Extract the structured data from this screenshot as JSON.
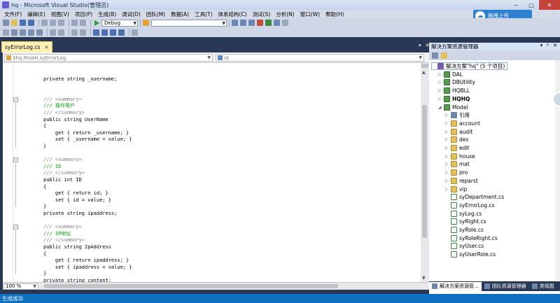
{
  "window": {
    "title": "hq - Microsoft Visual Studio(管理员)",
    "controls": [
      "−",
      "□",
      "✕"
    ]
  },
  "menu": [
    "文件(F)",
    "编辑(E)",
    "视图(V)",
    "项目(P)",
    "生成(B)",
    "调试(D)",
    "团队(M)",
    "数据(A)",
    "工具(T)",
    "体系结构(C)",
    "测试(S)",
    "分析(N)",
    "窗口(W)",
    "帮助(H)"
  ],
  "upload": {
    "label": "拖拽上传",
    "icon": "cloud-upload-icon",
    "close": "✕"
  },
  "toolbar": {
    "config": "Debug",
    "platform": ""
  },
  "editor": {
    "tab_label": "syErrorLog.cs",
    "tab_close": "✕",
    "nav_left": "$hq.Model.syErrorLog",
    "nav_right": "id",
    "zoom": "100 %",
    "lines": [
      {
        "t": "private string _username;",
        "k": "n"
      },
      {
        "t": "",
        "k": "n"
      },
      {
        "t": "",
        "k": "n"
      },
      {
        "t": "/// <summary>",
        "k": "g"
      },
      {
        "t": "/// 操作用户",
        "k": "c"
      },
      {
        "t": "/// </summary>",
        "k": "g"
      },
      {
        "t": "public string UserName",
        "k": "n"
      },
      {
        "t": "{",
        "k": "n"
      },
      {
        "t": "    get { return _username; }",
        "k": "n"
      },
      {
        "t": "    set { _username = value; }",
        "k": "n"
      },
      {
        "t": "}",
        "k": "n"
      },
      {
        "t": "",
        "k": "n"
      },
      {
        "t": "/// <summary>",
        "k": "g"
      },
      {
        "t": "/// ID",
        "k": "c"
      },
      {
        "t": "/// </summary>",
        "k": "g"
      },
      {
        "t": "public int ID",
        "k": "n"
      },
      {
        "t": "{",
        "k": "n"
      },
      {
        "t": "    get { return id; }",
        "k": "n"
      },
      {
        "t": "    set { id = value; }",
        "k": "n"
      },
      {
        "t": "}",
        "k": "n"
      },
      {
        "t": "private string ipaddress;",
        "k": "n"
      },
      {
        "t": "",
        "k": "n"
      },
      {
        "t": "/// <summary>",
        "k": "g"
      },
      {
        "t": "/// IP地址",
        "k": "c"
      },
      {
        "t": "/// </summary>",
        "k": "g"
      },
      {
        "t": "public string IpAddress",
        "k": "n"
      },
      {
        "t": "{",
        "k": "n"
      },
      {
        "t": "    get { return ipaddress; }",
        "k": "n"
      },
      {
        "t": "    set { ipaddress = value; }",
        "k": "n"
      },
      {
        "t": "}",
        "k": "n"
      },
      {
        "t": "private string content;",
        "k": "n"
      }
    ]
  },
  "solution_explorer": {
    "title": "解决方案资源管理器",
    "title_buttons": [
      "▾",
      "ᵖ",
      "✕"
    ],
    "tree": [
      {
        "label": "解决方案\"hq\" (5 个项目)",
        "icon": "solution-icon",
        "level": 0,
        "selected": true,
        "arrow": ""
      },
      {
        "label": "DAL",
        "icon": "project-icon",
        "level": 1,
        "arrow": "▷"
      },
      {
        "label": "DBUtility",
        "icon": "project-icon",
        "level": 1,
        "arrow": "▷"
      },
      {
        "label": "HQBLL",
        "icon": "project-icon",
        "level": 1,
        "arrow": "▷"
      },
      {
        "label": "HQHQ",
        "icon": "project-icon",
        "level": 1,
        "arrow": "▷",
        "bold": true
      },
      {
        "label": "Model",
        "icon": "project-icon",
        "level": 1,
        "arrow": "◢"
      },
      {
        "label": "引用",
        "icon": "references-icon",
        "level": 2,
        "arrow": "▷"
      },
      {
        "label": "account",
        "icon": "folder-icon",
        "level": 2,
        "arrow": "▷"
      },
      {
        "label": "audit",
        "icon": "folder-icon",
        "level": 2,
        "arrow": "▷"
      },
      {
        "label": "des",
        "icon": "folder-icon",
        "level": 2,
        "arrow": "▷"
      },
      {
        "label": "edit",
        "icon": "folder-icon",
        "level": 2,
        "arrow": "▷"
      },
      {
        "label": "house",
        "icon": "folder-icon",
        "level": 2,
        "arrow": "▷"
      },
      {
        "label": "mat",
        "icon": "folder-icon",
        "level": 2,
        "arrow": "▷"
      },
      {
        "label": "pro",
        "icon": "folder-icon",
        "level": 2,
        "arrow": "▷"
      },
      {
        "label": "reparst",
        "icon": "folder-icon",
        "level": 2,
        "arrow": "▷"
      },
      {
        "label": "vip",
        "icon": "folder-icon",
        "level": 2,
        "arrow": "▷"
      },
      {
        "label": "syDepartment.cs",
        "icon": "cs-file-icon",
        "level": 2,
        "arrow": ""
      },
      {
        "label": "syErrorLog.cs",
        "icon": "cs-file-icon",
        "level": 2,
        "arrow": ""
      },
      {
        "label": "syLog.cs",
        "icon": "cs-file-icon",
        "level": 2,
        "arrow": ""
      },
      {
        "label": "syRight.cs",
        "icon": "cs-file-icon",
        "level": 2,
        "arrow": ""
      },
      {
        "label": "syRole.cs",
        "icon": "cs-file-icon",
        "level": 2,
        "arrow": ""
      },
      {
        "label": "syRoleRight.cs",
        "icon": "cs-file-icon",
        "level": 2,
        "arrow": ""
      },
      {
        "label": "syUser.cs",
        "icon": "cs-file-icon",
        "level": 2,
        "arrow": ""
      },
      {
        "label": "syUserRole.cs",
        "icon": "cs-file-icon",
        "level": 2,
        "arrow": ""
      }
    ],
    "bottom_tabs": [
      "解决方案资源管...",
      "团队资源管理器",
      "类视图"
    ]
  },
  "status": {
    "text": "生成成功"
  },
  "colors": {
    "chrome": "#293955",
    "status": "#0e70c0",
    "tab_active": "#fcf0b5",
    "comment": "#00a000",
    "doc_tag": "#808080"
  }
}
